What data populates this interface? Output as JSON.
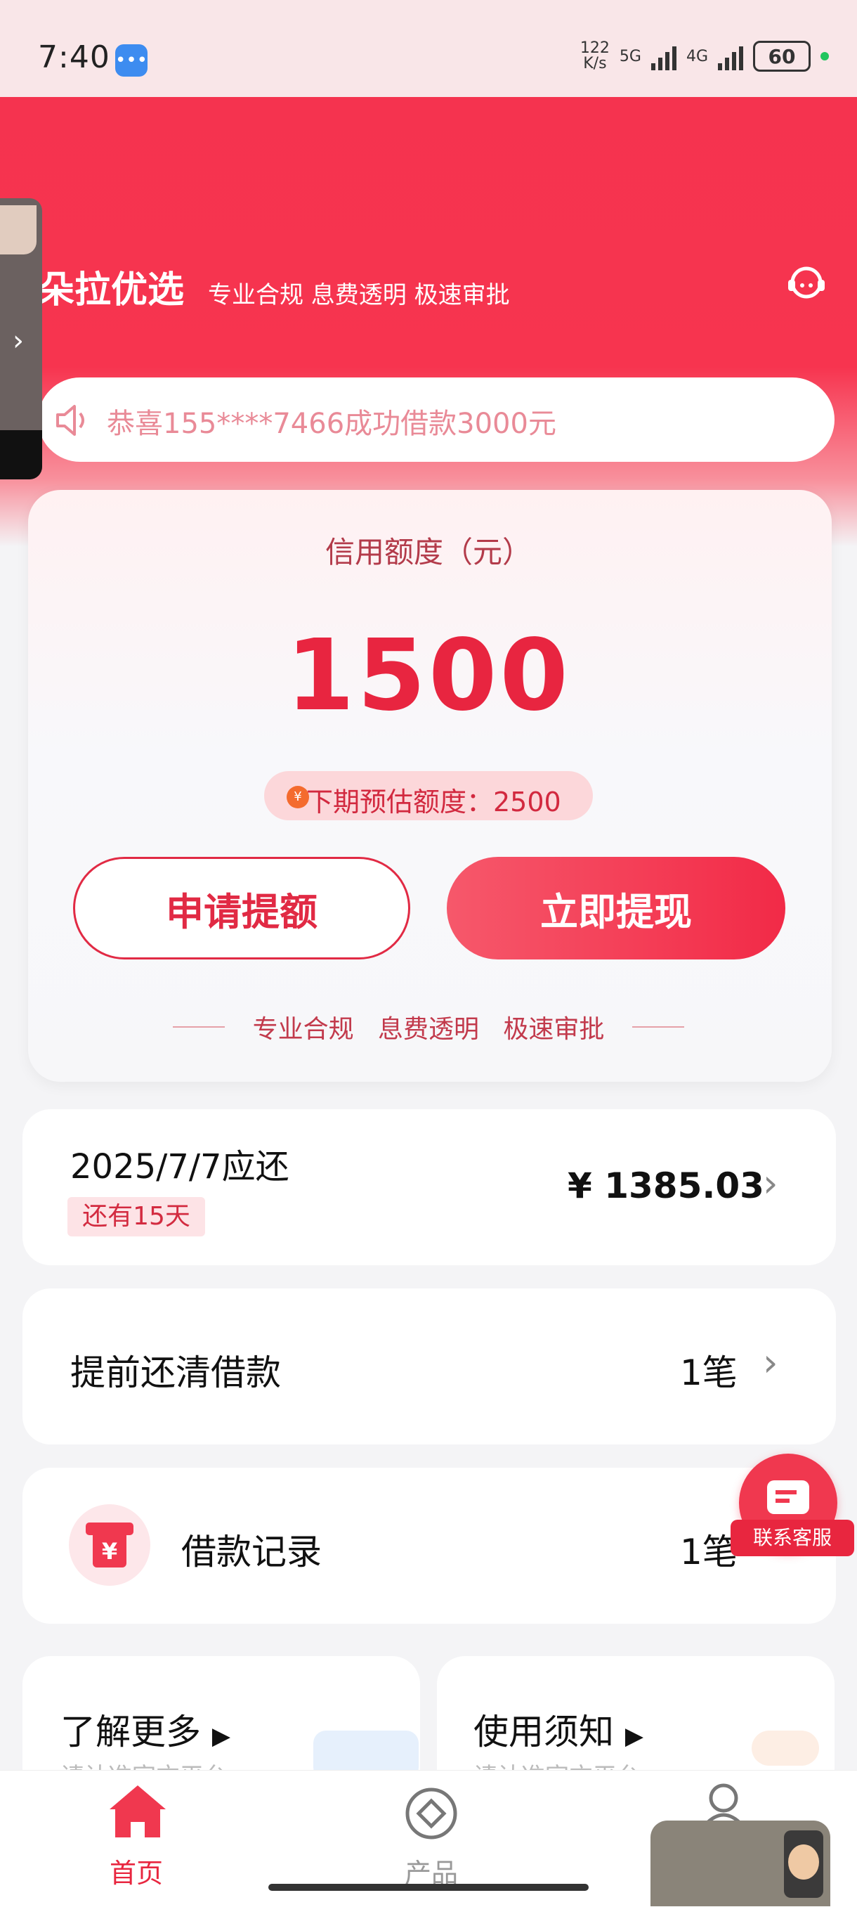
{
  "status_bar": {
    "time": "7:40",
    "network_speed": "122\nK/s",
    "network_1": "5G",
    "network_2": "4G",
    "battery": "60"
  },
  "header": {
    "brand": "朵拉优选",
    "slogan": "专业合规 息费透明 极速审批",
    "notice": "恭喜155****7466成功借款3000元"
  },
  "credit": {
    "label": "信用额度（元）",
    "value": "1500",
    "next_estimate": "下期预估额度：2500",
    "apply_button": "申请提额",
    "withdraw_button": "立即提现",
    "tagline": "专业合规   息费透明   极速审批"
  },
  "due": {
    "date_label": "2025/7/7应还",
    "days_left": "还有15天",
    "amount": "¥ 1385.03"
  },
  "early_repay": {
    "label": "提前还清借款",
    "count": "1笔"
  },
  "loan_records": {
    "label": "借款记录",
    "count": "1笔"
  },
  "floating_service": {
    "label": "联系客服"
  },
  "info_cards": [
    {
      "title": "了解更多",
      "subtitle": "请认准官方平台"
    },
    {
      "title": "使用须知",
      "subtitle": "请认准官方平台"
    }
  ],
  "bottom_nav": [
    {
      "label": "首页",
      "active": true
    },
    {
      "label": "产品",
      "active": false
    },
    {
      "label": "",
      "active": false
    }
  ],
  "colors": {
    "primary": "#f22a47",
    "header": "#f5334f"
  }
}
